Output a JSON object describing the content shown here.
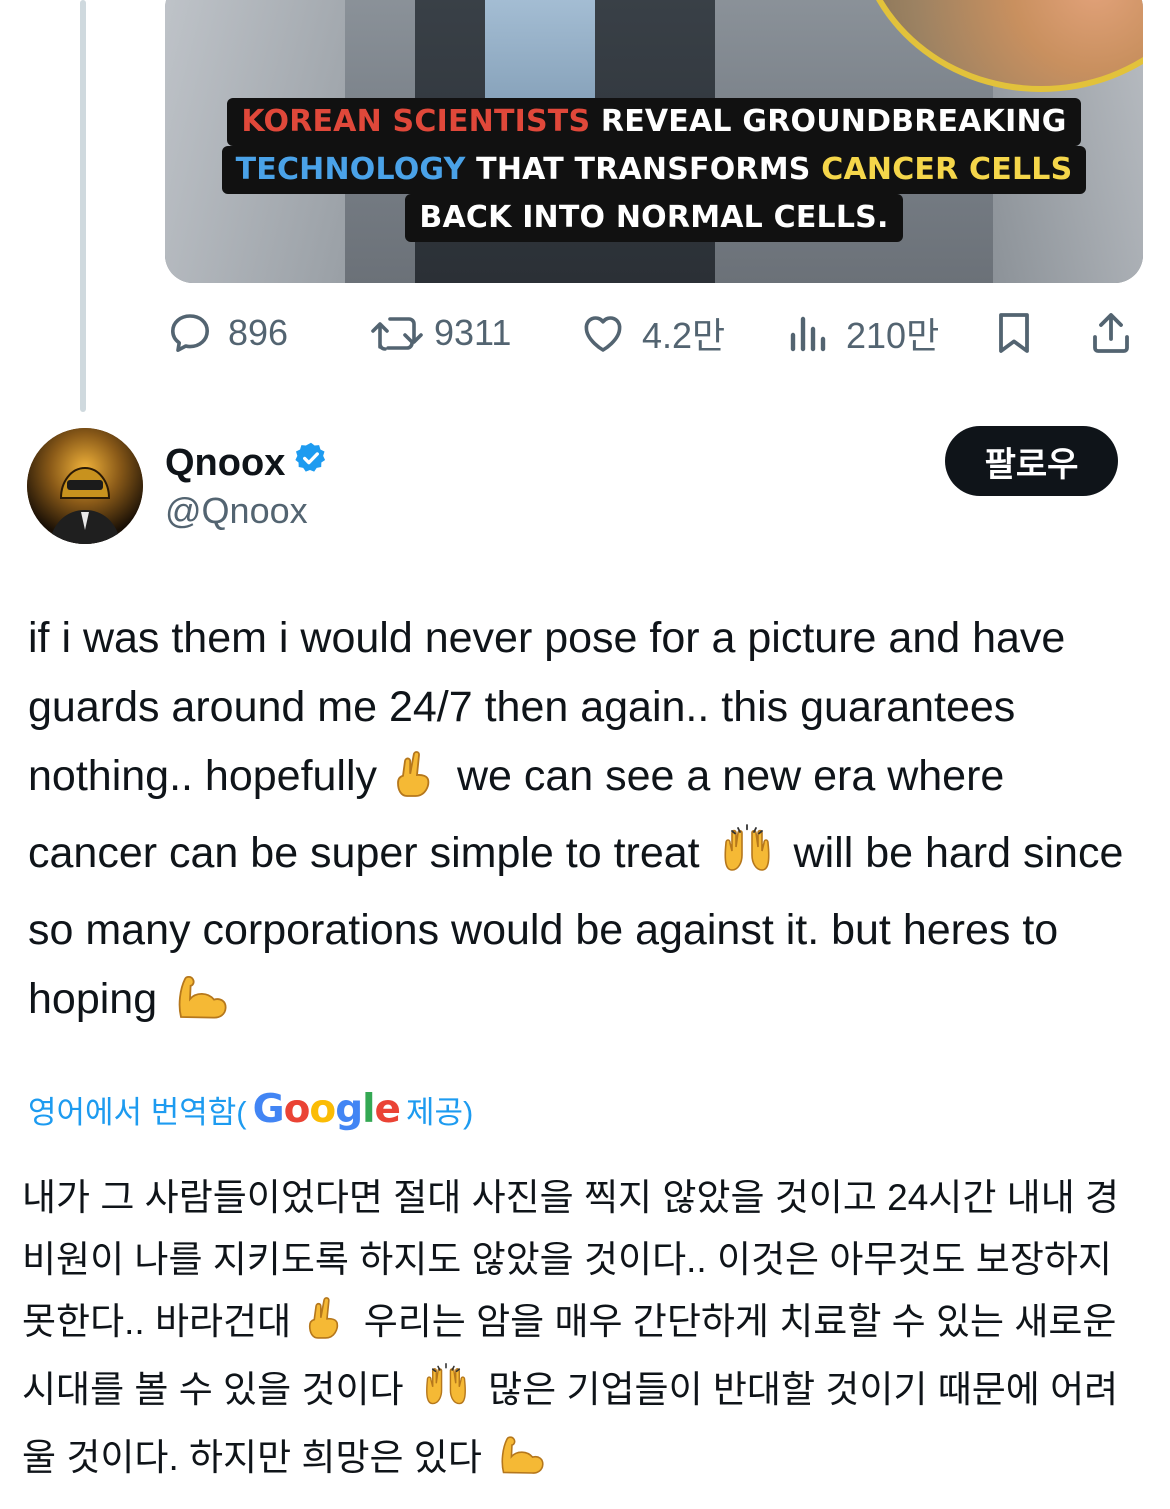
{
  "media": {
    "caption": {
      "line1_red": "KOREAN SCIENTISTS",
      "line1_rest": " REVEAL GROUNDBREAKING",
      "line2_blue": "TECHNOLOGY",
      "line2_mid": " THAT TRANSFORMS ",
      "line2_yellow": "CANCER CELLS",
      "line3": "BACK INTO NORMAL CELLS."
    }
  },
  "actions": {
    "replies": "896",
    "reposts": "9311",
    "likes": "4.2만",
    "views": "210만",
    "icons": [
      "reply-icon",
      "repost-icon",
      "like-icon",
      "views-icon",
      "bookmark-icon",
      "share-icon"
    ]
  },
  "author": {
    "name": "Qnoox",
    "handle": "@Qnoox",
    "verified": true,
    "follow_label": "팔로우"
  },
  "tweet": {
    "p1": "if i was them i would never pose for a picture and have guards around me 24/7 then again.. this guarantees nothing.. hopefully",
    "p2": "we can see a new era where cancer can be super simple to treat",
    "p3": "will be hard since so many corporations would be against it. but heres to hoping"
  },
  "translation": {
    "prefix": "영어에서 번역함(",
    "provider": "Google",
    "suffix": " 제공)",
    "t1": "내가 그 사람들이었다면 절대 사진을 찍지 않았을 것이고 24시간 내내 경비원이 나를 지키도록 하지도 않았을 것이다.. 이것은 아무것도 보장하지 못한다.. 바라건대",
    "t2": "우리는 암을 매우 간단하게 치료할 수 있는 새로운 시대를 볼 수 있을 것이다",
    "t3": "많은 기업들이 반대할 것이기 때문에 어려울 것이다. 하지만 희망은 있다"
  },
  "colors": {
    "accent": "#1d9bf0",
    "text": "#0f1419",
    "muted": "#536471",
    "follow_bg": "#0f1419"
  }
}
